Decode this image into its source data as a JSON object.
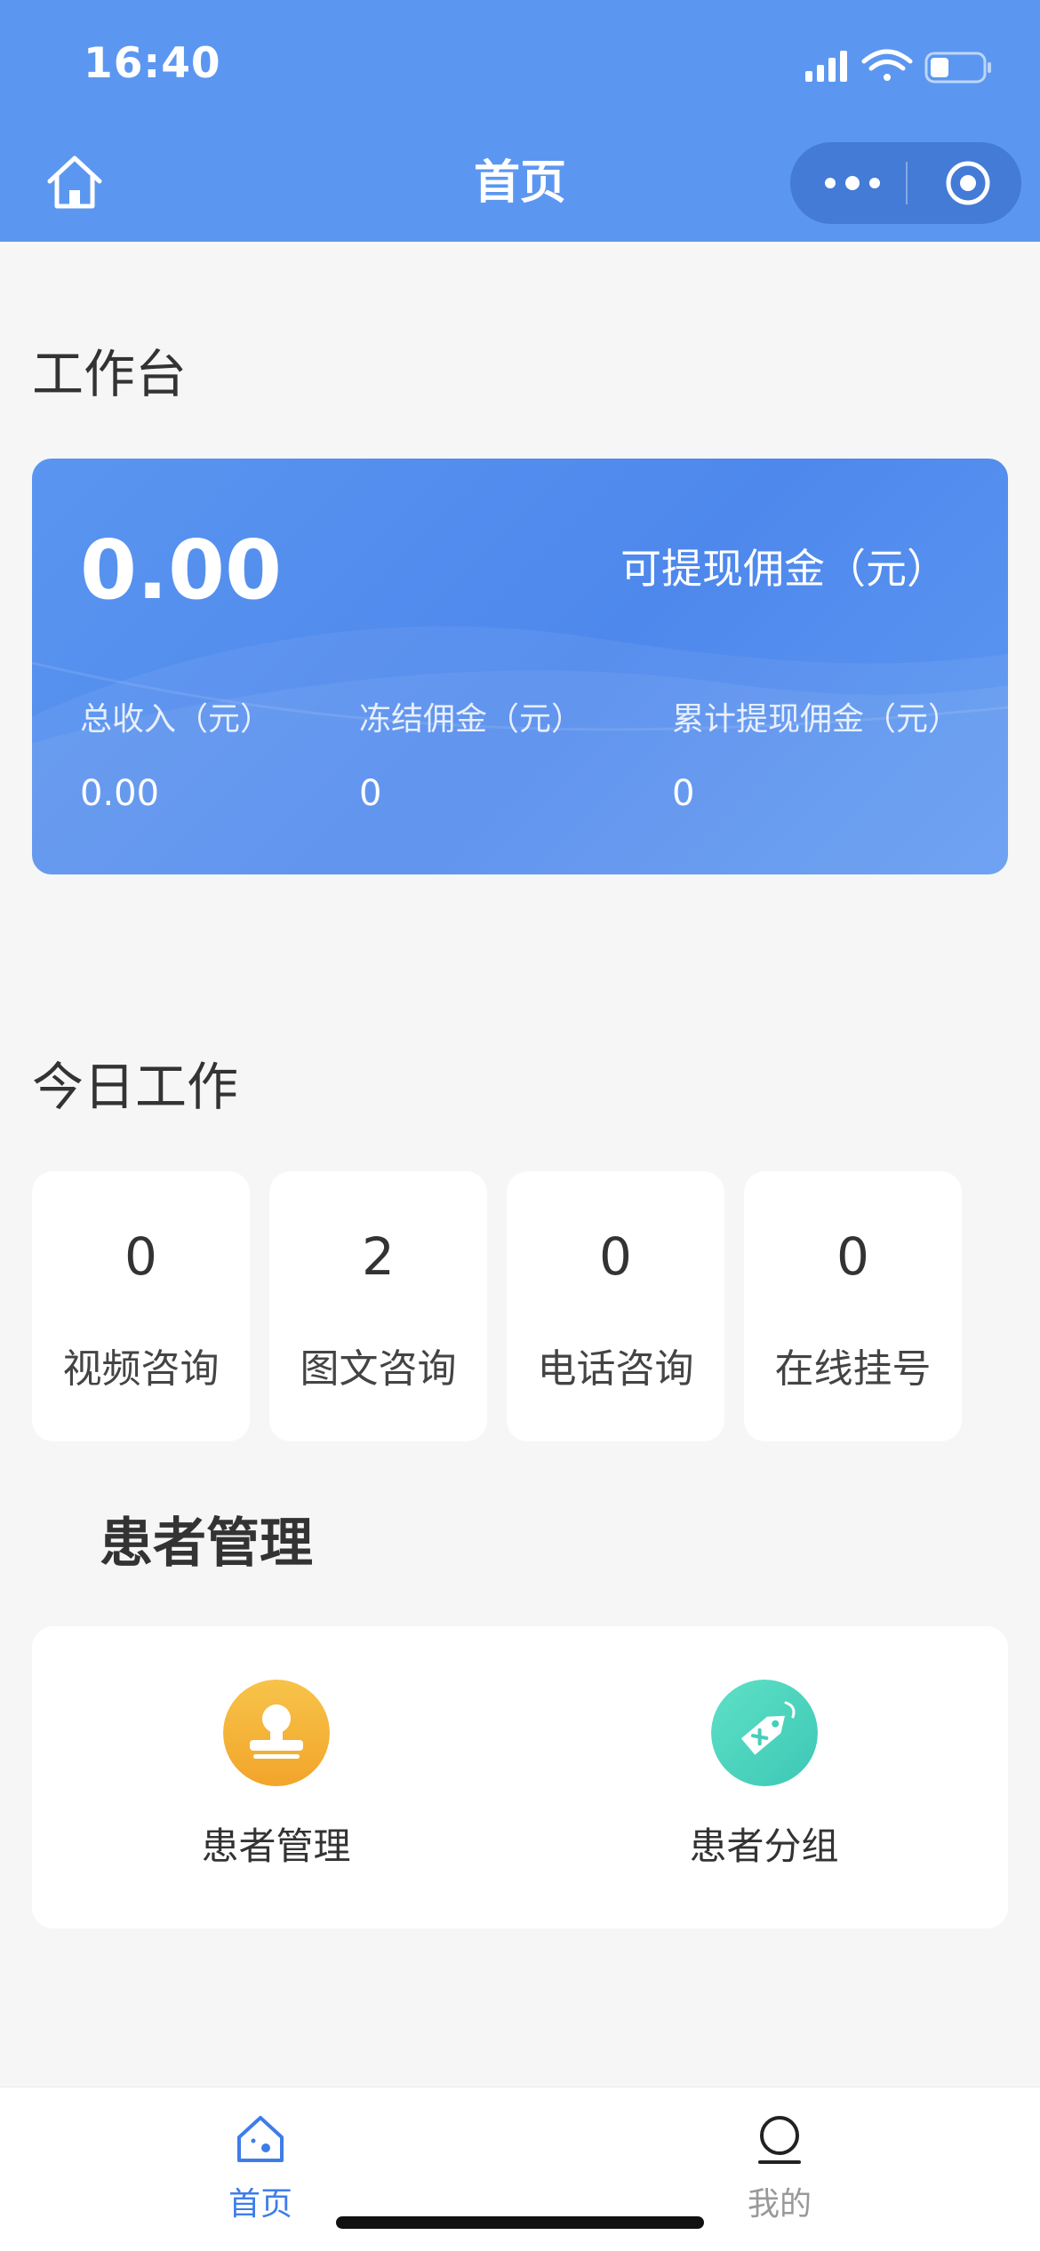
{
  "status_bar": {
    "time": "16:40"
  },
  "nav": {
    "title": "首页"
  },
  "workbench": {
    "title": "工作台",
    "available_amount": "0.00",
    "available_label": "可提现佣金（元）",
    "stats": [
      {
        "label": "总收入（元）",
        "value": "0.00"
      },
      {
        "label": "冻结佣金（元）",
        "value": "0"
      },
      {
        "label": "累计提现佣金（元）",
        "value": "0"
      }
    ]
  },
  "today": {
    "title": "今日工作",
    "items": [
      {
        "count": "0",
        "label": "视频咨询"
      },
      {
        "count": "2",
        "label": "图文咨询"
      },
      {
        "count": "0",
        "label": "电话咨询"
      },
      {
        "count": "0",
        "label": "在线挂号"
      }
    ]
  },
  "patients": {
    "title": "患者管理",
    "items": [
      {
        "label": "患者管理",
        "icon": "stamp-icon"
      },
      {
        "label": "患者分组",
        "icon": "tag-icon"
      }
    ]
  },
  "tabbar": {
    "items": [
      {
        "label": "首页",
        "icon": "home-icon",
        "active": true
      },
      {
        "label": "我的",
        "icon": "user-icon",
        "active": false
      }
    ]
  },
  "colors": {
    "primary": "#5b97f0",
    "card_blue": "#4e88ec",
    "stamp_orange": "#f5b63a",
    "tag_teal": "#4dd6c0",
    "tab_active": "#3e7de8",
    "tab_inactive": "#999999"
  }
}
